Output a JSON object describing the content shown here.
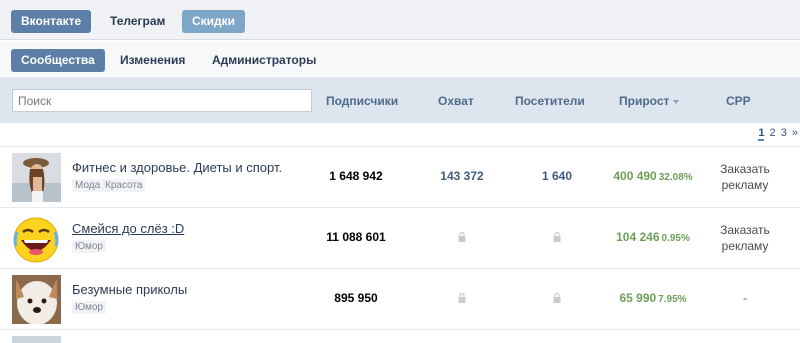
{
  "tabs": {
    "vk": "Вконтакте",
    "telegram": "Телеграм",
    "discounts": "Скидки"
  },
  "subtabs": {
    "communities": "Сообщества",
    "changes": "Изменения",
    "admins": "Администраторы"
  },
  "search": {
    "placeholder": "Поиск",
    "value": ""
  },
  "columns": {
    "subscribers": "Подписчики",
    "reach": "Охват",
    "visitors": "Посетители",
    "growth": "Прирост",
    "cpp": "CPP"
  },
  "pagination": {
    "pages": [
      "1",
      "2",
      "3"
    ],
    "current": "1",
    "next": "»"
  },
  "rows": [
    {
      "name": "Фитнес и здоровье. Диеты и спорт.",
      "tags": [
        "Мода",
        "Красота"
      ],
      "subscribers": "1 648 942",
      "reach": "143 372",
      "visitors": "1 640",
      "growth": "400 490",
      "growth_pct": "32.08%",
      "cpp_line1": "Заказать",
      "cpp_line2": "рекламу"
    },
    {
      "name": "Смейся до слёз :D",
      "tags": [
        "Юмор"
      ],
      "subscribers": "11 088 601",
      "reach": "",
      "visitors": "",
      "growth": "104 246",
      "growth_pct": "0.95%",
      "cpp_line1": "Заказать",
      "cpp_line2": "рекламу"
    },
    {
      "name": "Безумные приколы",
      "tags": [
        "Юмор"
      ],
      "subscribers": "895 950",
      "reach": "",
      "visitors": "",
      "growth": "65 990",
      "growth_pct": "7.95%",
      "cpp_line1": "-",
      "cpp_line2": ""
    }
  ],
  "colors": {
    "accent": "#5b7fa6",
    "growth": "#6e9e58",
    "header_bg": "#dde5ee"
  }
}
